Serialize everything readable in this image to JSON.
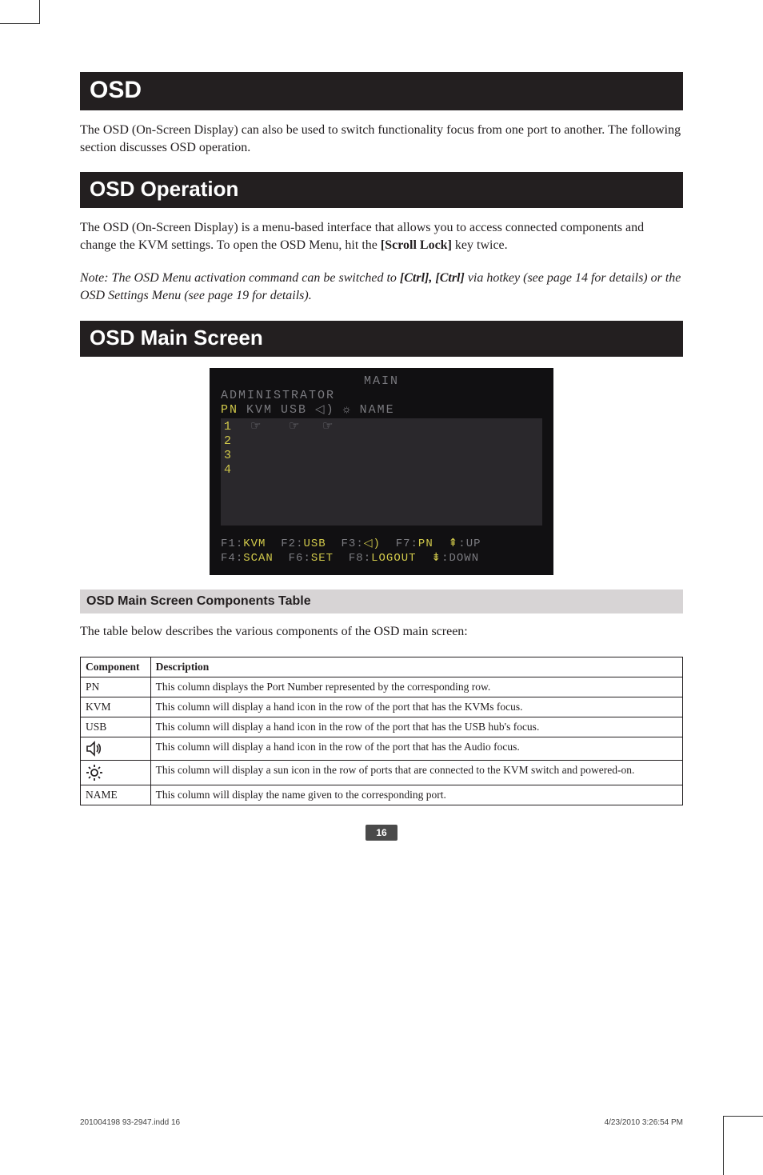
{
  "sections": {
    "osd": {
      "title": "OSD",
      "intro": "The OSD (On-Screen Display) can also be used to switch functionality focus from one port to another. The following section discusses OSD operation."
    },
    "operation": {
      "title": "OSD Operation",
      "p1_lead": "The OSD (On-Screen Display) is a menu-based interface that allows you to access connected components and change the KVM settings. To open the OSD Menu, hit the ",
      "p1_bold": "[Scroll Lock]",
      "p1_tail": " key twice.",
      "note_lead": "Note: The OSD Menu activation command can be switched to ",
      "note_bold": "[Ctrl], [Ctrl]",
      "note_tail": " via hotkey (see page 14 for details) or the OSD Settings Menu (see page 19 for details)."
    },
    "main_screen": {
      "title": "OSD Main Screen"
    },
    "components": {
      "subtitle": "OSD Main Screen Components Table",
      "intro": "The table below describes the various components of the OSD main screen:",
      "headers": {
        "c1": "Component",
        "c2": "Description"
      },
      "rows": [
        {
          "comp": "PN",
          "desc": "This column displays the Port Number represented by the corresponding row."
        },
        {
          "comp": "KVM",
          "desc": "This column will display a hand icon in the row of the port that has the KVMs focus."
        },
        {
          "comp": "USB",
          "desc": "This column will display a hand icon in the row of the port that has the USB hub's focus."
        },
        {
          "comp": "speaker-icon",
          "desc": "This column will display a hand icon in the row of the port that has the Audio focus."
        },
        {
          "comp": "sun-icon",
          "desc": "This column will display a sun icon in the row of ports that are connected to the KVM switch and powered-on."
        },
        {
          "comp": "NAME",
          "desc": "This column will display the name given to the corresponding port."
        }
      ]
    }
  },
  "osd_screenshot": {
    "title": "MAIN",
    "user": "ADMINISTRATOR",
    "cols": {
      "pn": "PN",
      "kvm": "KVM",
      "usb": "USB",
      "name": "NAME"
    },
    "ports": [
      "1",
      "2",
      "3",
      "4"
    ],
    "footer": {
      "line1": {
        "f1": "F1",
        "f1v": "KVM",
        "f2": "F2",
        "f2v": "USB",
        "f3": "F3",
        "f3v": "①",
        "f7": "F7",
        "f7v": "PN",
        "up": "↥",
        "upv": "UP"
      },
      "line2": {
        "f4": "F4",
        "f4v": "SCAN",
        "f6": "F6",
        "f6v": "SET",
        "f8": "F8",
        "f8v": "LOGOUT",
        "dn": "↧",
        "dnv": "DOWN"
      }
    }
  },
  "page_number": "16",
  "footer_meta": {
    "left": "201004198  93-2947.indd   16",
    "right": "4/23/2010   3:26:54 PM"
  }
}
